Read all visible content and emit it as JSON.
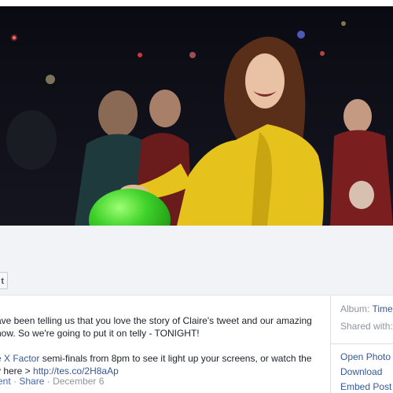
{
  "post": {
    "tag_button_label": "t",
    "caption_line_1": "ave been telling us that you love the story of Claire's tweet and our amazing",
    "caption_line_2": "now. So we're going to put it on telly - TONIGHT!",
    "caption_line_3_link": "e X Factor",
    "caption_line_3_text": " semi-finals from 8pm to see it light up your screens, or watch the",
    "caption_line_4_text": "v here > ",
    "caption_line_4_link": "http://tes.co/2H8aAp",
    "action_comment": "ent",
    "separator": " · ",
    "action_share": "Share",
    "date": "December 6"
  },
  "sidebar": {
    "album_label": "Album: ",
    "album_value": "Time",
    "shared_with_label": "Shared with:",
    "open_photo_viewer": "Open Photo V",
    "download": "Download",
    "embed_post": "Embed Post"
  },
  "colors": {
    "link_blue": "#365899",
    "muted_gray": "#90949c",
    "coat_yellow": "#e6c21c",
    "balloon_green": "#3fd12a"
  }
}
